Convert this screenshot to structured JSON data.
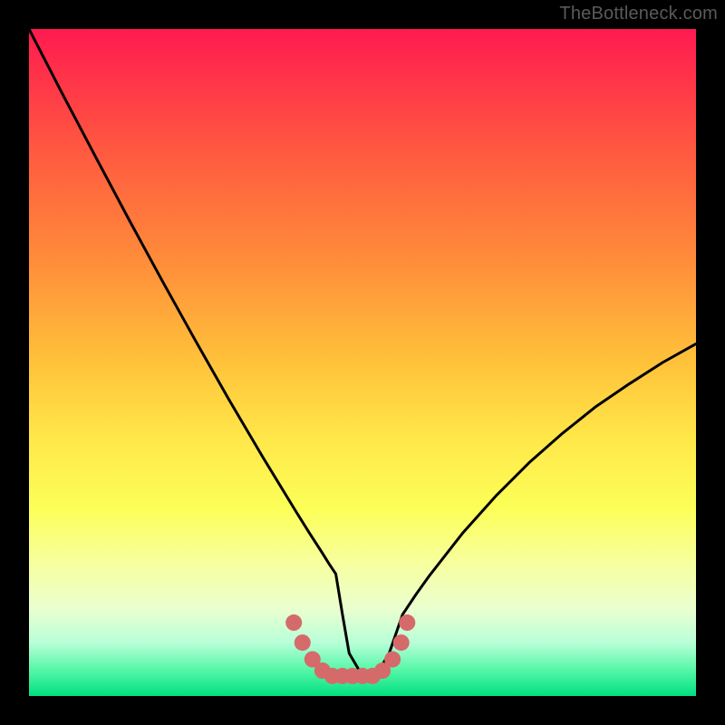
{
  "watermark": "TheBottleneck.com",
  "chart_data": {
    "type": "line",
    "title": "",
    "xlabel": "",
    "ylabel": "",
    "xlim": [
      0,
      100
    ],
    "ylim": [
      0,
      100
    ],
    "grid": false,
    "series": [
      {
        "name": "curve",
        "x": [
          0,
          5,
          10,
          15,
          20,
          25,
          30,
          35,
          37.5,
          40,
          42,
          44,
          45,
          46,
          47,
          48,
          50,
          52,
          54,
          56,
          58,
          60,
          65,
          70,
          75,
          80,
          85,
          90,
          95,
          100
        ],
        "y": [
          100,
          90.3,
          80.8,
          71.4,
          62.2,
          53.2,
          44.4,
          35.9,
          31.8,
          27.7,
          24.5,
          21.4,
          19.8,
          18.3,
          12.2,
          6.4,
          3.0,
          3.0,
          6.4,
          12.2,
          15.2,
          18.0,
          24.4,
          30.0,
          35.0,
          39.4,
          43.4,
          46.8,
          50.0,
          52.8
        ]
      },
      {
        "name": "highlight-dots",
        "x": [
          39.7,
          41.0,
          42.5,
          44.0,
          45.5,
          47.0,
          48.5,
          50.0,
          51.5,
          53.0,
          54.5,
          55.8,
          56.7
        ],
        "y": [
          11.0,
          8.0,
          5.5,
          3.8,
          3.0,
          3.0,
          3.0,
          3.0,
          3.0,
          3.8,
          5.5,
          8.0,
          11.0
        ]
      }
    ],
    "colors": {
      "curve_stroke": "#000000",
      "dot_fill": "#d56a6a",
      "gradient_top": "#ff1a50",
      "gradient_bottom": "#00e080"
    }
  }
}
